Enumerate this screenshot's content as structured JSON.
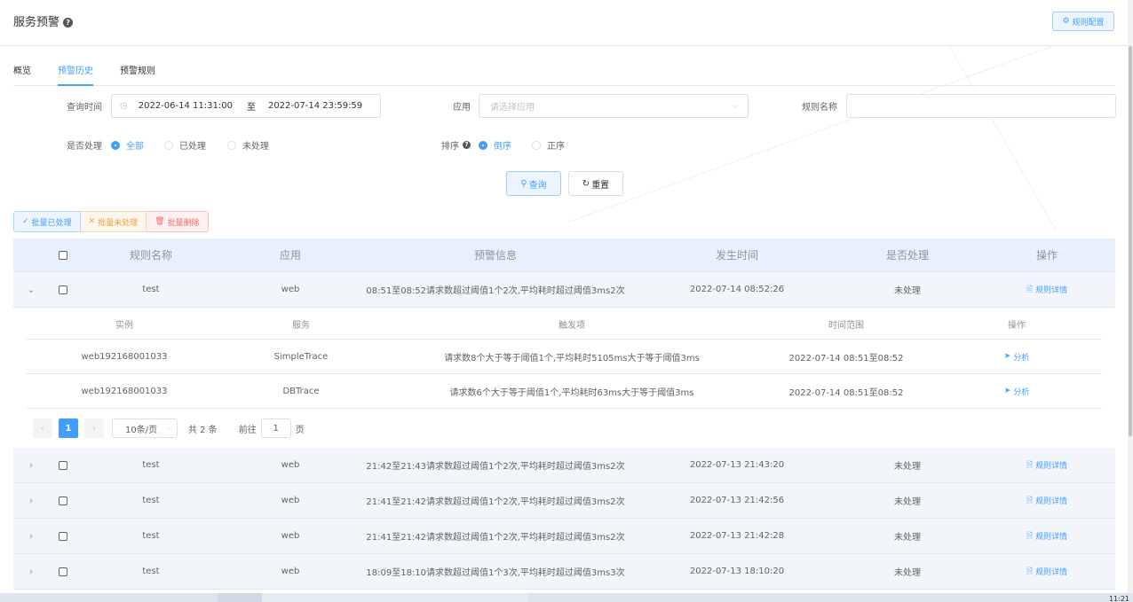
{
  "header": {
    "title": "服务预警",
    "rule_config_label": "规则配置"
  },
  "tabs": [
    {
      "label": "概览"
    },
    {
      "label": "预警历史"
    },
    {
      "label": "预警规则"
    }
  ],
  "filters": {
    "query_time_label": "查询时间",
    "start_time": "2022-06-14 11:31:00",
    "range_separator": "至",
    "end_time": "2022-07-14 23:59:59",
    "app_label": "应用",
    "app_placeholder": "请选择应用",
    "rule_name_label": "规则名称",
    "rule_name_value": "",
    "handled_label": "是否处理",
    "handled_options": [
      "全部",
      "已处理",
      "未处理"
    ],
    "handled_selected": "全部",
    "sort_label": "排序",
    "sort_options": [
      "倒序",
      "正序"
    ],
    "sort_selected": "倒序",
    "query_button": "查询",
    "reset_button": "重置"
  },
  "batch": {
    "done": "批量已处理",
    "undone": "批量未处理",
    "delete": "批量删除"
  },
  "table": {
    "headers": [
      "规则名称",
      "应用",
      "预警信息",
      "发生时间",
      "是否处理",
      "操作"
    ],
    "rows": [
      {
        "rule": "test",
        "app": "web",
        "info": "08:51至08:52请求数超过阈值1个2次,平均耗时超过阈值3ms2次",
        "time": "2022-07-14 08:52:26",
        "status": "未处理",
        "action": "规则详情"
      },
      {
        "rule": "test",
        "app": "web",
        "info": "21:42至21:43请求数超过阈值1个2次,平均耗时超过阈值3ms2次",
        "time": "2022-07-13 21:43:20",
        "status": "未处理",
        "action": "规则详情"
      },
      {
        "rule": "test",
        "app": "web",
        "info": "21:41至21:42请求数超过阈值1个2次,平均耗时超过阈值3ms2次",
        "time": "2022-07-13 21:42:56",
        "status": "未处理",
        "action": "规则详情"
      },
      {
        "rule": "test",
        "app": "web",
        "info": "21:41至21:42请求数超过阈值1个2次,平均耗时超过阈值3ms2次",
        "time": "2022-07-13 21:42:28",
        "status": "未处理",
        "action": "规则详情"
      },
      {
        "rule": "test",
        "app": "web",
        "info": "18:09至18:10请求数超过阈值1个3次,平均耗时超过阈值3ms3次",
        "time": "2022-07-13 18:10:20",
        "status": "未处理",
        "action": "规则详情"
      }
    ]
  },
  "sub_table": {
    "headers": [
      "实例",
      "服务",
      "触发项",
      "时间范围",
      "操作"
    ],
    "rows": [
      {
        "instance": "web192168001033",
        "service": "SimpleTrace",
        "trigger": "请求数8个大于等于阈值1个,平均耗时5105ms大于等于阈值3ms",
        "range": "2022-07-14 08:51至08:52",
        "action": "分析"
      },
      {
        "instance": "web192168001033",
        "service": "DBTrace",
        "trigger": "请求数6个大于等于阈值1个,平均耗时63ms大于等于阈值3ms",
        "range": "2022-07-14 08:51至08:52",
        "action": "分析"
      }
    ]
  },
  "pagination": {
    "current_page": "1",
    "page_size": "10条/页",
    "total": "共 2 条",
    "goto_label": "前往",
    "goto_value": "1",
    "page_suffix": "页"
  },
  "taskbar": {
    "clock": "11:21"
  },
  "colors": {
    "accent": "#409eff",
    "warning": "#e6a23c",
    "danger": "#f56c6c"
  }
}
